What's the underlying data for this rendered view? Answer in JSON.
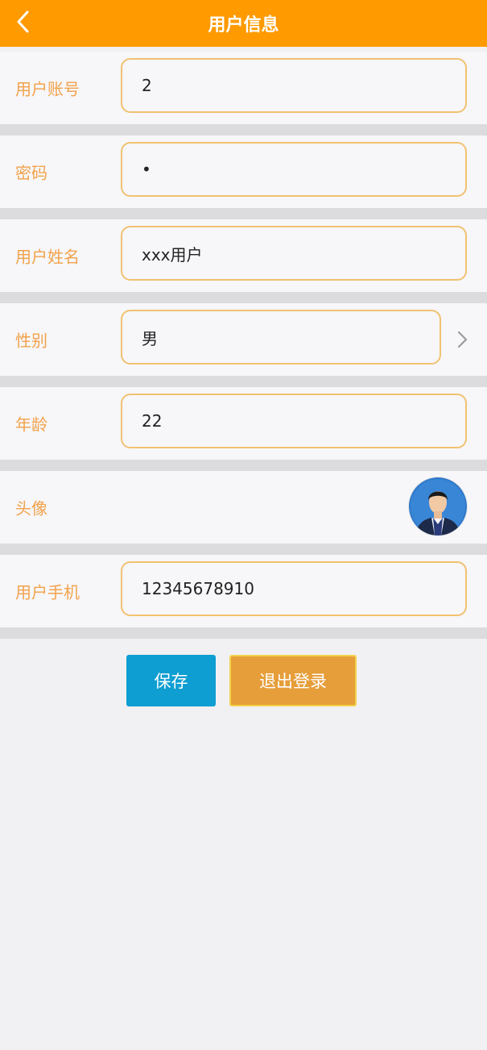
{
  "header": {
    "title": "用户信息"
  },
  "form": {
    "account": {
      "label": "用户账号",
      "value": "2"
    },
    "password": {
      "label": "密码",
      "value": "•"
    },
    "name": {
      "label": "用户姓名",
      "value": "xxx用户"
    },
    "gender": {
      "label": "性别",
      "value": "男"
    },
    "age": {
      "label": "年龄",
      "value": "22"
    },
    "avatar": {
      "label": "头像"
    },
    "phone": {
      "label": "用户手机",
      "value": "12345678910"
    }
  },
  "buttons": {
    "save": "保存",
    "logout": "退出登录"
  },
  "colors": {
    "header": "#ff9a00",
    "label": "#f2a24a",
    "field_border": "#f0c270",
    "save_button": "#0e9ed1",
    "logout_button": "#e69e3a"
  },
  "icons": {
    "back": "chevron-left-icon",
    "select": "chevron-right-icon"
  }
}
